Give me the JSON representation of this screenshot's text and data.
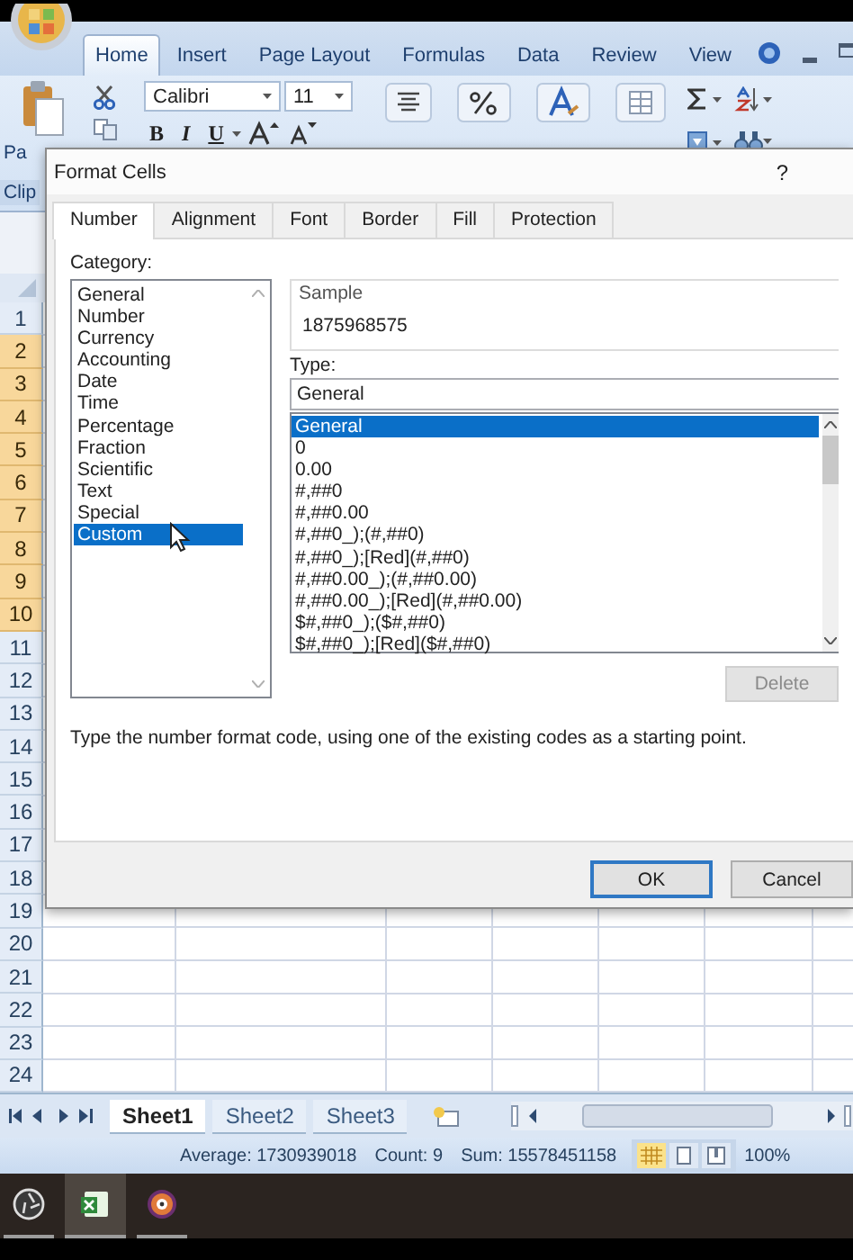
{
  "ribbon": {
    "tabs": [
      {
        "label": "Home",
        "selected": true
      },
      {
        "label": "Insert",
        "selected": false
      },
      {
        "label": "Page Layout",
        "selected": false
      },
      {
        "label": "Formulas",
        "selected": false
      },
      {
        "label": "Data",
        "selected": false
      },
      {
        "label": "Review",
        "selected": false
      },
      {
        "label": "View",
        "selected": false
      }
    ],
    "paste_label": "Pa",
    "group_label": "Clip",
    "font_name": "Calibri",
    "font_size": "11",
    "format_buttons": [
      "B",
      "I",
      "U"
    ]
  },
  "sheet": {
    "rows": [
      {
        "label": "1",
        "selected": false
      },
      {
        "label": "2",
        "selected": true
      },
      {
        "label": "3",
        "selected": true
      },
      {
        "label": "4",
        "selected": true
      },
      {
        "label": "5",
        "selected": true
      },
      {
        "label": "6",
        "selected": true
      },
      {
        "label": "7",
        "selected": true
      },
      {
        "label": "8",
        "selected": true
      },
      {
        "label": "9",
        "selected": true
      },
      {
        "label": "10",
        "selected": true
      },
      {
        "label": "11",
        "selected": false
      },
      {
        "label": "12",
        "selected": false
      },
      {
        "label": "13",
        "selected": false
      },
      {
        "label": "14",
        "selected": false
      },
      {
        "label": "15",
        "selected": false
      },
      {
        "label": "16",
        "selected": false
      },
      {
        "label": "17",
        "selected": false
      },
      {
        "label": "18",
        "selected": false
      },
      {
        "label": "19",
        "selected": false
      },
      {
        "label": "20",
        "selected": false
      },
      {
        "label": "21",
        "selected": false
      },
      {
        "label": "22",
        "selected": false
      },
      {
        "label": "23",
        "selected": false
      },
      {
        "label": "24",
        "selected": false
      }
    ]
  },
  "dialog": {
    "title": "Format Cells",
    "help": "?",
    "tabs": [
      {
        "label": "Number",
        "selected": true
      },
      {
        "label": "Alignment",
        "selected": false
      },
      {
        "label": "Font",
        "selected": false
      },
      {
        "label": "Border",
        "selected": false
      },
      {
        "label": "Fill",
        "selected": false
      },
      {
        "label": "Protection",
        "selected": false
      }
    ],
    "category_label": "Category:",
    "categories": [
      {
        "label": "General",
        "selected": false
      },
      {
        "label": "Number",
        "selected": false
      },
      {
        "label": "Currency",
        "selected": false
      },
      {
        "label": "Accounting",
        "selected": false
      },
      {
        "label": "Date",
        "selected": false
      },
      {
        "label": "Time",
        "selected": false
      },
      {
        "label": "Percentage",
        "selected": false
      },
      {
        "label": "Fraction",
        "selected": false
      },
      {
        "label": "Scientific",
        "selected": false
      },
      {
        "label": "Text",
        "selected": false
      },
      {
        "label": "Special",
        "selected": false
      },
      {
        "label": "Custom",
        "selected": true
      }
    ],
    "sample_label": "Sample",
    "sample_value": "1875968575",
    "type_label": "Type:",
    "type_value": "General",
    "types": [
      {
        "label": "General",
        "selected": true
      },
      {
        "label": "0",
        "selected": false
      },
      {
        "label": "0.00",
        "selected": false
      },
      {
        "label": "#,##0",
        "selected": false
      },
      {
        "label": "#,##0.00",
        "selected": false
      },
      {
        "label": "#,##0_);(#,##0)",
        "selected": false
      },
      {
        "label": "#,##0_);[Red](#,##0)",
        "selected": false
      },
      {
        "label": "#,##0.00_);(#,##0.00)",
        "selected": false
      },
      {
        "label": "#,##0.00_);[Red](#,##0.00)",
        "selected": false
      },
      {
        "label": "$#,##0_);($#,##0)",
        "selected": false
      },
      {
        "label": "$#,##0_);[Red]($#,##0)",
        "selected": false
      }
    ],
    "delete_button": {
      "label": "Delete",
      "disabled": true
    },
    "description": "Type the number format code, using one of the existing codes as a starting point.",
    "buttons": [
      {
        "label": "OK",
        "default": true
      },
      {
        "label": "Cancel",
        "default": false
      }
    ]
  },
  "sheet_tabs": [
    {
      "label": "Sheet1",
      "selected": true
    },
    {
      "label": "Sheet2",
      "selected": false
    },
    {
      "label": "Sheet3",
      "selected": false
    }
  ],
  "status_bar": {
    "average": "Average: 1730939018",
    "count": "Count: 9",
    "sum": "Sum: 15578451158",
    "zoom": "100%"
  },
  "taskbar": [
    {
      "kind": "aperture",
      "active": false
    },
    {
      "kind": "spreadsheet",
      "active": true
    },
    {
      "kind": "disc",
      "active": false
    }
  ]
}
